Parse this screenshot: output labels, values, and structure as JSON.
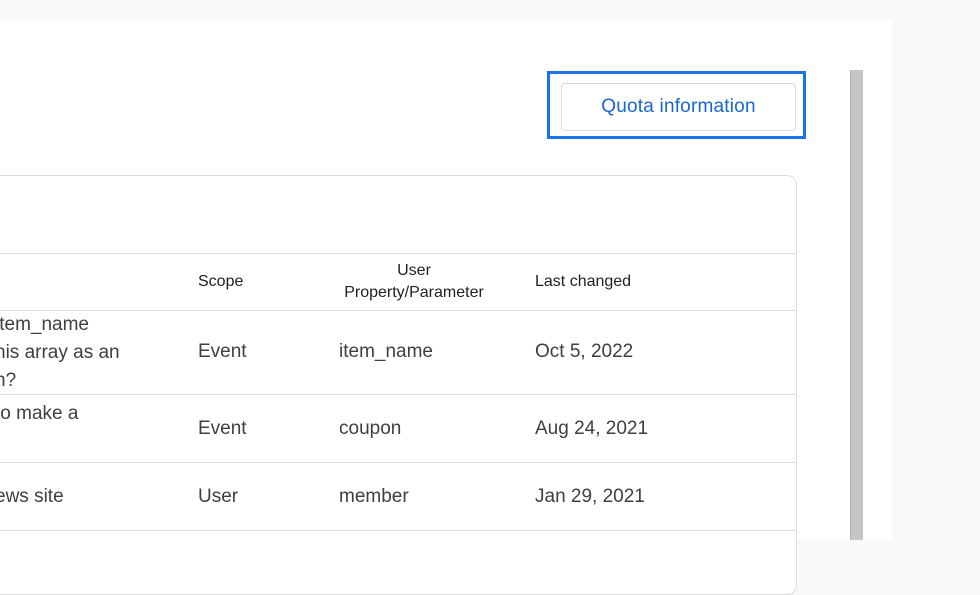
{
  "toolbar": {
    "quota_label": "Quota information"
  },
  "table": {
    "headers": {
      "scope": "Scope",
      "param_line1": "User",
      "param_line2": "Property/Parameter",
      "last_changed": "Last changed"
    },
    "rows": [
      {
        "name": "item_name\nhis array as an\nn?",
        "scope": "Event",
        "param": "item_name",
        "last_changed": "Oct 5, 2022"
      },
      {
        "name": "to make a",
        "scope": "Event",
        "param": "coupon",
        "last_changed": "Aug 24, 2021"
      },
      {
        "name": "ews site",
        "scope": "User",
        "param": "member",
        "last_changed": "Jan 29, 2021"
      }
    ]
  },
  "colors": {
    "accent": "#1a73e8",
    "button_text": "#1967d2",
    "border": "#dadce0"
  }
}
